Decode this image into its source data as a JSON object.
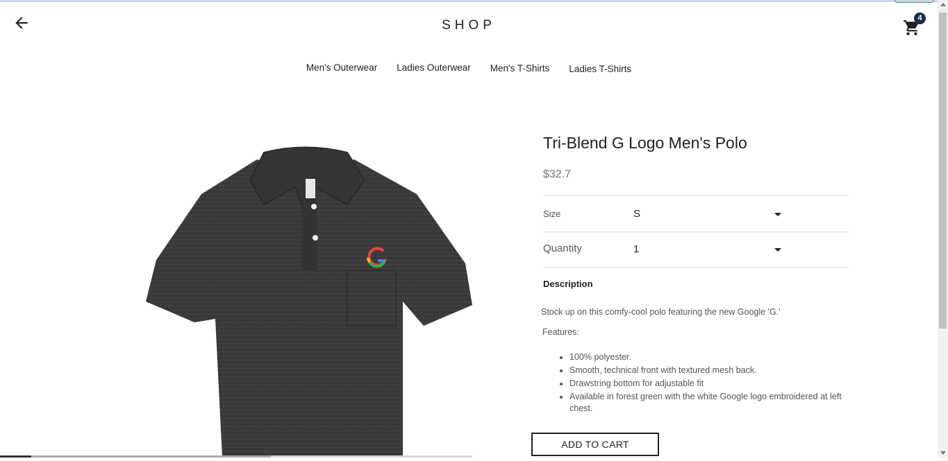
{
  "header": {
    "logo": "SHOP",
    "back_icon": "arrow-left-icon",
    "cart_icon": "shopping-cart-icon",
    "cart_count": "4"
  },
  "nav": {
    "tabs": [
      {
        "label": "Men's Outerwear"
      },
      {
        "label": "Ladies Outerwear"
      },
      {
        "label": "Men's T-Shirts"
      },
      {
        "label": "Ladies T-Shirts"
      }
    ]
  },
  "product": {
    "title": "Tri-Blend G Logo Men's Polo",
    "price": "$32.7",
    "size_label": "Size",
    "size_value": "S",
    "quantity_label": "Quantity",
    "quantity_value": "1",
    "description_heading": "Description",
    "description": "Stock up on this comfy-cool polo featuring the new Google 'G.'",
    "features_label": "Features:",
    "features": [
      "100% polyester.",
      "Smooth, technical front with textured mesh back.",
      "Drawstring bottom for adjustable fit",
      "Available in forest green with the white Google logo embroidered at left chest."
    ],
    "add_to_cart": "ADD TO CART"
  },
  "colors": {
    "badge": "#172c50",
    "text": "#202020",
    "muted": "#757575"
  }
}
